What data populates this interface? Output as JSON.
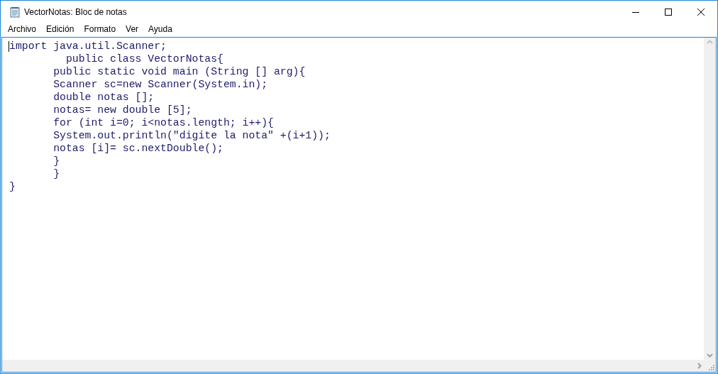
{
  "window": {
    "title": "VectorNotas: Bloc de notas"
  },
  "menu": [
    "Archivo",
    "Edición",
    "Formato",
    "Ver",
    "Ayuda"
  ],
  "editor": {
    "lines": [
      "import java.util.Scanner;",
      "         public class VectorNotas{",
      "       public static void main (String [] arg){",
      "       Scanner sc=new Scanner(System.in);",
      "       double notas [];",
      "       notas= new double [5];",
      "       for (int i=0; i<notas.length; i++){",
      "       System.out.println(\"digite la nota\" +(i+1));",
      "       notas [i]= sc.nextDouble();",
      "       }",
      "       }",
      "}"
    ]
  }
}
